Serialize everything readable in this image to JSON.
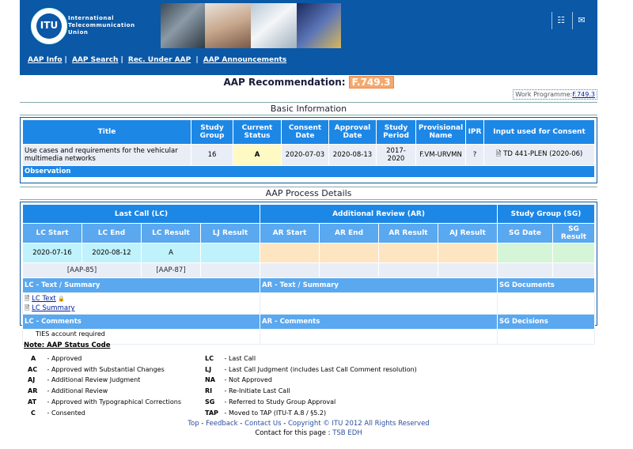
{
  "header": {
    "org_lines": [
      "International",
      "Telecommunication",
      "Union"
    ],
    "logo_text": "ITU",
    "icons": [
      "sitemap-icon",
      "mail-icon"
    ],
    "nav": [
      "AAP Info",
      "AAP Search",
      "Rec. Under AAP",
      "AAP Announcements"
    ]
  },
  "page": {
    "title_prefix": "AAP Recommendation:",
    "code": "F.749.3",
    "work_programme_label": "Work Programme:",
    "work_programme_link": "F.749.3"
  },
  "basic": {
    "section_title": "Basic Information",
    "headers": [
      "Title",
      "Study Group",
      "Current Status",
      "Consent Date",
      "Approval Date",
      "Study Period",
      "Provisional Name",
      "IPR",
      "Input used for Consent"
    ],
    "row": {
      "title": "Use cases and requirements for the vehicular multimedia networks",
      "study_group": "16",
      "status": "A",
      "consent_date": "2020-07-03",
      "approval_date": "2020-08-13",
      "study_period": "2017-2020",
      "provisional_name": "F.VM-URVMN",
      "ipr": "?",
      "input": "TD 441-PLEN (2020-06)"
    },
    "observation": "Observation"
  },
  "process": {
    "section_title": "AAP Process Details",
    "groups": [
      "Last Call (LC)",
      "Additional Review (AR)",
      "Study Group (SG)"
    ],
    "subheaders": [
      "LC Start",
      "LC End",
      "LC Result",
      "LJ Result",
      "AR Start",
      "AR End",
      "AR Result",
      "AJ Result",
      "SG Date",
      "SG Result"
    ],
    "lc_start": "2020-07-16",
    "lc_end": "2020-08-12",
    "lc_result": "A",
    "link_start": "[AAP-85]",
    "link_result": "[AAP-87]",
    "lc_text_hdr": "LC - Text / Summary",
    "ar_text_hdr": "AR - Text / Summary",
    "sg_docs_hdr": "SG Documents",
    "lc_text_link": "LC Text",
    "lc_summary_link": "LC Summary",
    "lc_comments_hdr": "LC - Comments",
    "ar_comments_hdr": "AR - Comments",
    "sg_decisions_hdr": "SG Decisions"
  },
  "notes": {
    "ties": "TIES account required",
    "status_title": "Note: AAP Status Code",
    "left": [
      {
        "code": "A",
        "desc": "- Approved"
      },
      {
        "code": "AC",
        "desc": "- Approved with Substantial Changes"
      },
      {
        "code": "AJ",
        "desc": "- Additional Review Judgment"
      },
      {
        "code": "AR",
        "desc": "- Additional Review"
      },
      {
        "code": "AT",
        "desc": "- Approved with Typographical Corrections"
      },
      {
        "code": "C",
        "desc": "- Consented"
      }
    ],
    "right": [
      {
        "code": "LC",
        "desc": "- Last Call"
      },
      {
        "code": "LJ",
        "desc": "- Last Call Judgment (includes Last Call Comment resolution)"
      },
      {
        "code": "NA",
        "desc": "- Not Approved"
      },
      {
        "code": "RI",
        "desc": "- Re-Initiate Last Call"
      },
      {
        "code": "SG",
        "desc": "- Referred to Study Group Approval"
      },
      {
        "code": "TAP",
        "desc": "- Moved to TAP (ITU-T A.8 / §5.2)"
      }
    ]
  },
  "footer": {
    "links": [
      "Top",
      "Feedback",
      "Contact Us",
      "Copyright © ITU 2012  All Rights Reserved"
    ],
    "contact_prefix": "Contact for this page : ",
    "contact_link": "TSB EDH"
  },
  "colors": {
    "header_blue": "#0a58a6",
    "table_header": "#1d87e6",
    "code_badge": "#f4a96e"
  }
}
